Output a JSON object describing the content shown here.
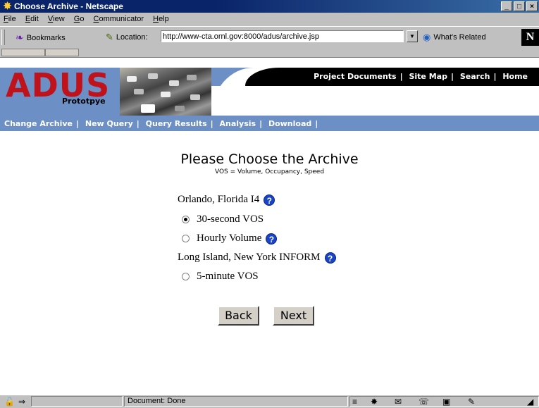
{
  "window": {
    "title": "Choose Archive - Netscape",
    "min": "_",
    "max": "□",
    "close": "×"
  },
  "menu": {
    "items": [
      {
        "pre": "",
        "key": "F",
        "post": "ile"
      },
      {
        "pre": "",
        "key": "E",
        "post": "dit"
      },
      {
        "pre": "",
        "key": "V",
        "post": "iew"
      },
      {
        "pre": "",
        "key": "G",
        "post": "o"
      },
      {
        "pre": "",
        "key": "C",
        "post": "ommunicator"
      },
      {
        "pre": "",
        "key": "H",
        "post": "elp"
      }
    ]
  },
  "toolbar": {
    "bookmarks_label": "Bookmarks",
    "location_label": "Location:",
    "url": "http://www-cta.ornl.gov:8000/adus/archive.jsp",
    "related_label": "What's Related",
    "logo_letter": "N"
  },
  "header": {
    "logo": "ADUS",
    "logo_sub": "Prototpye",
    "top_links": [
      "Project Documents",
      "Site Map",
      "Search",
      "Home"
    ],
    "sub_links": [
      "Change Archive",
      "New Query",
      "Query Results",
      "Analysis",
      "Download"
    ]
  },
  "page": {
    "title": "Please Choose the Archive",
    "subtitle": "VOS = Volume, Occupancy, Speed",
    "help_glyph": "?",
    "groups": [
      {
        "label": "Orlando, Florida I4",
        "options": [
          {
            "label": "30-second VOS",
            "selected": true,
            "help": false
          },
          {
            "label": "Hourly Volume",
            "selected": false,
            "help": true
          }
        ]
      },
      {
        "label": "Long Island, New York INFORM",
        "options": [
          {
            "label": "5-minute VOS",
            "selected": false,
            "help": false
          }
        ]
      }
    ],
    "back_label": "Back",
    "next_label": "Next"
  },
  "status": {
    "text": "Document: Done"
  },
  "colors": {
    "banner": "#6c8fc6",
    "logo": "#c0121a",
    "title_bar": "#0a246a"
  }
}
